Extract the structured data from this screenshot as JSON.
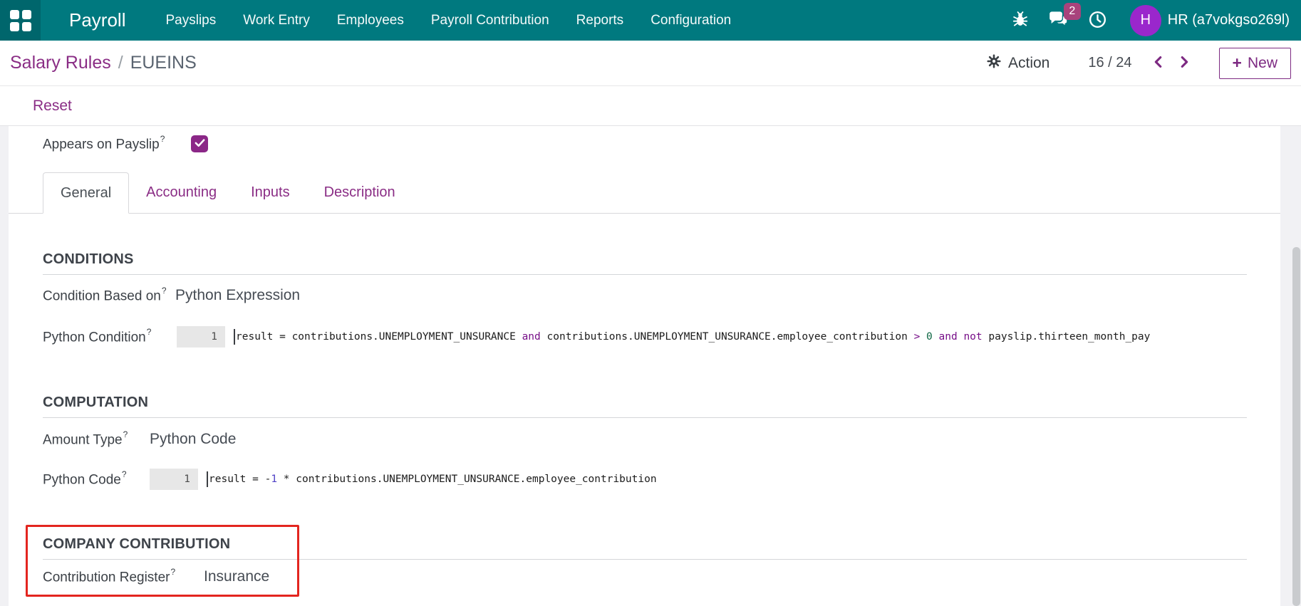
{
  "navbar": {
    "brand": "Payroll",
    "menu": [
      {
        "label": "Payslips"
      },
      {
        "label": "Work Entry"
      },
      {
        "label": "Employees"
      },
      {
        "label": "Payroll Contribution"
      },
      {
        "label": "Reports"
      },
      {
        "label": "Configuration"
      }
    ],
    "systray": {
      "chat_badge": "2",
      "user_initial": "H",
      "user_name": "HR (a7vokgso269l)"
    }
  },
  "control_panel": {
    "breadcrumb": {
      "parent": "Salary Rules",
      "separator": "/",
      "current": "EUEINS"
    },
    "action_label": "Action",
    "pager_value": "16 / 24",
    "new_plus": "+",
    "new_label": "New"
  },
  "status_bar": {
    "reset_label": "Reset"
  },
  "form": {
    "appears_on_payslip": {
      "label": "Appears on Payslip",
      "help": "?",
      "checked": true
    },
    "tabs": [
      {
        "label": "General",
        "active": true
      },
      {
        "label": "Accounting",
        "active": false
      },
      {
        "label": "Inputs",
        "active": false
      },
      {
        "label": "Description",
        "active": false
      }
    ],
    "sections": {
      "conditions": {
        "title": "CONDITIONS",
        "condition_based_on": {
          "label": "Condition Based on",
          "help": "?",
          "value": "Python Expression"
        },
        "python_condition": {
          "label": "Python Condition",
          "help": "?",
          "line_number": "1",
          "code_text": "result = contributions.UNEMPLOYMENT_UNSURANCE and contributions.UNEMPLOYMENT_UNSURANCE.employee_contribution > 0 and not payslip.thirteen_month_pay",
          "code_tokens": [
            {
              "text": "result = contributions.UNEMPLOYMENT_UNSURANCE ",
              "type": "plain"
            },
            {
              "text": "and",
              "type": "keyword"
            },
            {
              "text": " contributions.UNEMPLOYMENT_UNSURANCE.employee_contribution ",
              "type": "plain"
            },
            {
              "text": ">",
              "type": "operator"
            },
            {
              "text": " ",
              "type": "plain"
            },
            {
              "text": "0",
              "type": "number"
            },
            {
              "text": " ",
              "type": "plain"
            },
            {
              "text": "and",
              "type": "keyword"
            },
            {
              "text": " ",
              "type": "plain"
            },
            {
              "text": "not",
              "type": "keyword"
            },
            {
              "text": " payslip.thirteen_month_pay",
              "type": "plain"
            }
          ]
        }
      },
      "computation": {
        "title": "COMPUTATION",
        "amount_type": {
          "label": "Amount Type",
          "help": "?",
          "value": "Python Code"
        },
        "python_code": {
          "label": "Python Code",
          "help": "?",
          "line_number": "1",
          "code_text": "result = -1 * contributions.UNEMPLOYMENT_UNSURANCE.employee_contribution",
          "code_tokens": [
            {
              "text": "result = ",
              "type": "plain"
            },
            {
              "text": "-",
              "type": "plain"
            },
            {
              "text": "1",
              "type": "number"
            },
            {
              "text": " * contributions.UNEMPLOYMENT_UNSURANCE.employee_contribution",
              "type": "plain"
            }
          ]
        }
      },
      "company_contribution": {
        "title": "COMPANY CONTRIBUTION",
        "contribution_register": {
          "label": "Contribution Register",
          "help": "?",
          "value": "Insurance"
        }
      }
    }
  },
  "colors": {
    "navbar_teal": "#00797f",
    "accent_purple": "#8a2d85",
    "checkbox_purple": "#8b2787",
    "avatar_purple": "#9a27cc",
    "badge_magenta": "#a8437c",
    "highlight_red": "#e3251f",
    "code_keyword": "#770f88",
    "code_number_green": "#0e6744",
    "code_number_violet": "#4f41c6"
  }
}
